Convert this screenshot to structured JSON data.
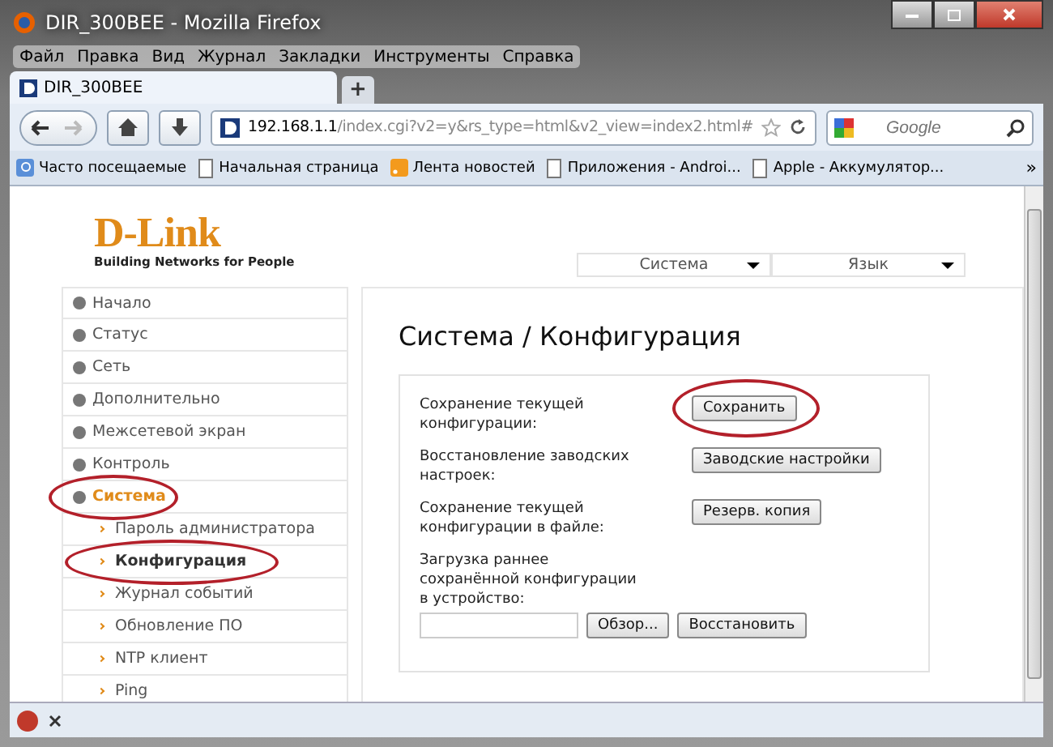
{
  "window": {
    "title": "DIR_300BEE - Mozilla Firefox",
    "controls": [
      {
        "kind": "minimize"
      },
      {
        "kind": "maximize"
      },
      {
        "kind": "close"
      }
    ]
  },
  "menu": [
    "Файл",
    "Правка",
    "Вид",
    "Журнал",
    "Закладки",
    "Инструменты",
    "Справка"
  ],
  "tabs": [
    {
      "label": "DIR_300BEE",
      "selected": true
    }
  ],
  "new_tab": "+",
  "address": {
    "host": "192.168.1.1",
    "path": "/index.cgi?v2=y&rs_type=html&v2_view=index2.html#"
  },
  "search": {
    "placeholder": "Google"
  },
  "bookmarks": [
    {
      "label": "Часто посещаемые",
      "kind": "smart"
    },
    {
      "label": "Начальная страница",
      "kind": "page"
    },
    {
      "label": "Лента новостей",
      "kind": "feed"
    },
    {
      "label": "Приложения - Androi...",
      "kind": "page"
    },
    {
      "label": "Apple - Аккумулятор...",
      "kind": "page"
    }
  ],
  "bookmarks_more": "»",
  "page": {
    "logo": {
      "brand": "D-Link",
      "tagline": "Building Networks for People"
    },
    "dropdowns": [
      "Система",
      "Язык"
    ],
    "nav": [
      {
        "label": "Начало",
        "expanded": false,
        "circled": false
      },
      {
        "label": "Статус",
        "expanded": false,
        "circled": false
      },
      {
        "label": "Сеть",
        "expanded": false,
        "circled": false
      },
      {
        "label": "Дополнительно",
        "expanded": false,
        "circled": false
      },
      {
        "label": "Межсетевой экран",
        "expanded": false,
        "circled": false
      },
      {
        "label": "Контроль",
        "expanded": false,
        "circled": false
      },
      {
        "label": "Система",
        "expanded": true,
        "circled": true,
        "children": [
          {
            "label": "Пароль администратора",
            "selected": false,
            "circled": false
          },
          {
            "label": "Конфигурация",
            "selected": true,
            "circled": true
          },
          {
            "label": "Журнал событий",
            "selected": false,
            "circled": false
          },
          {
            "label": "Обновление ПО",
            "selected": false,
            "circled": false
          },
          {
            "label": "NTP клиент",
            "selected": false,
            "circled": false
          },
          {
            "label": "Ping",
            "selected": false,
            "circled": false
          }
        ]
      }
    ],
    "title": "Система / Конфигурация",
    "rows": [
      {
        "kind": "action",
        "label": "Сохранение текущей конфигурации:",
        "buttons": [
          {
            "label": "Сохранить",
            "circled": true
          }
        ]
      },
      {
        "kind": "action",
        "label": "Восстановление заводских настроек:",
        "buttons": [
          {
            "label": "Заводские настройки",
            "circled": false
          }
        ]
      },
      {
        "kind": "action",
        "label": "Сохранение текущей конфигурации в файле:",
        "buttons": [
          {
            "label": "Резерв. копия",
            "circled": false
          }
        ]
      },
      {
        "kind": "file",
        "label": "Загрузка раннее сохранённой конфигурации в устройство:",
        "buttons": [
          {
            "label": "Обзор...",
            "circled": false
          },
          {
            "label": "Восстановить",
            "circled": false
          }
        ]
      }
    ]
  }
}
